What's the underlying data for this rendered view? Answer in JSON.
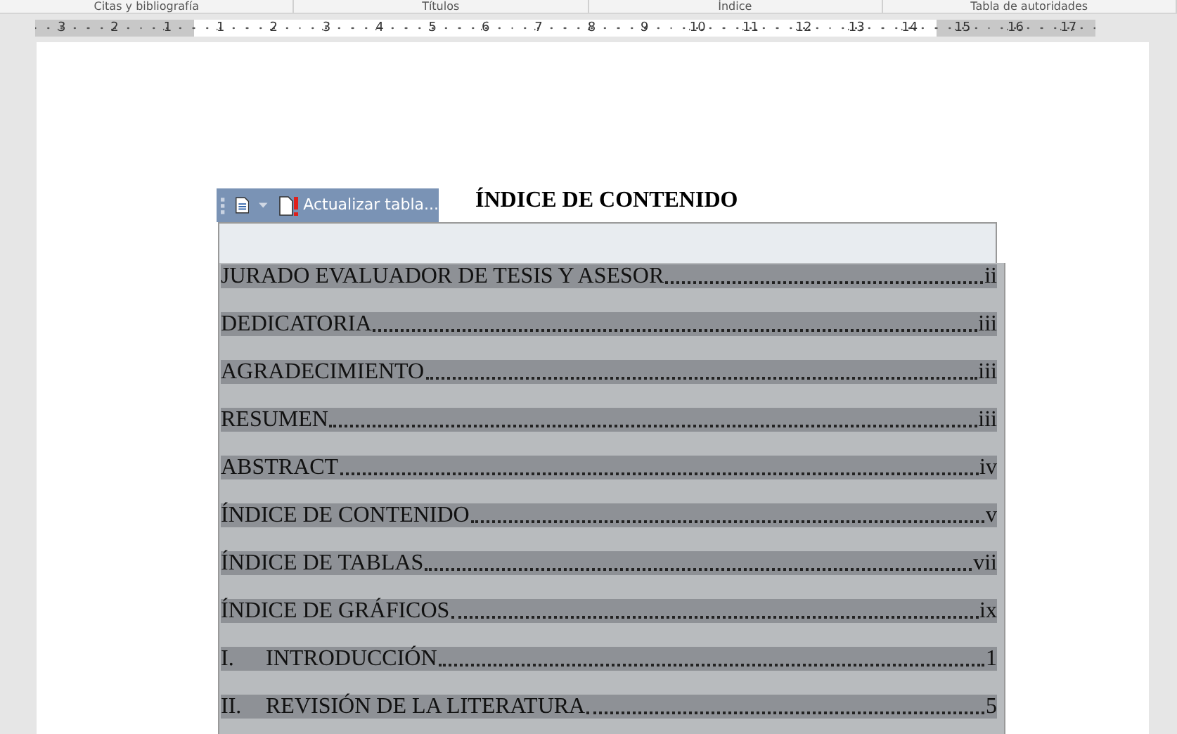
{
  "ribbon_groups": [
    "Citas y bibliografía",
    "Títulos",
    "Índice",
    "Tabla de autoridades"
  ],
  "ruler": {
    "left_numbers": [
      "3",
      "2",
      "1"
    ],
    "numbers": [
      "1",
      "2",
      "3",
      "4",
      "5",
      "6",
      "7",
      "8",
      "9",
      "10",
      "11",
      "12",
      "13",
      "14"
    ],
    "right_numbers": [
      "15",
      "16",
      "17"
    ]
  },
  "toc_toolbar": {
    "update_button": "Actualizar tabla..."
  },
  "heading": "ÍNDICE DE CONTENIDO",
  "entries": [
    {
      "kind": "plain",
      "label": "JURADO EVALUADOR DE TESIS Y ASESOR",
      "page": "ii"
    },
    {
      "kind": "plain",
      "label": "DEDICATORIA",
      "page": "iii"
    },
    {
      "kind": "plain",
      "label": "AGRADECIMIENTO",
      "page": "iii"
    },
    {
      "kind": "plain",
      "label": "RESUMEN",
      "page": "iii"
    },
    {
      "kind": "plain",
      "label": "ABSTRACT",
      "page": "iv"
    },
    {
      "kind": "plain",
      "label": "ÍNDICE DE CONTENIDO",
      "page": "v"
    },
    {
      "kind": "plain",
      "label": "ÍNDICE DE TABLAS",
      "page": "vii"
    },
    {
      "kind": "plain",
      "label": "ÍNDICE DE GRÁFICOS",
      "page": "ix"
    },
    {
      "kind": "numbered",
      "number": "I.",
      "label": "INTRODUCCIÓN",
      "page": "1"
    },
    {
      "kind": "numbered",
      "number": "II.",
      "label": "REVISIÓN DE LA LITERATURA",
      "page": "5"
    }
  ]
}
